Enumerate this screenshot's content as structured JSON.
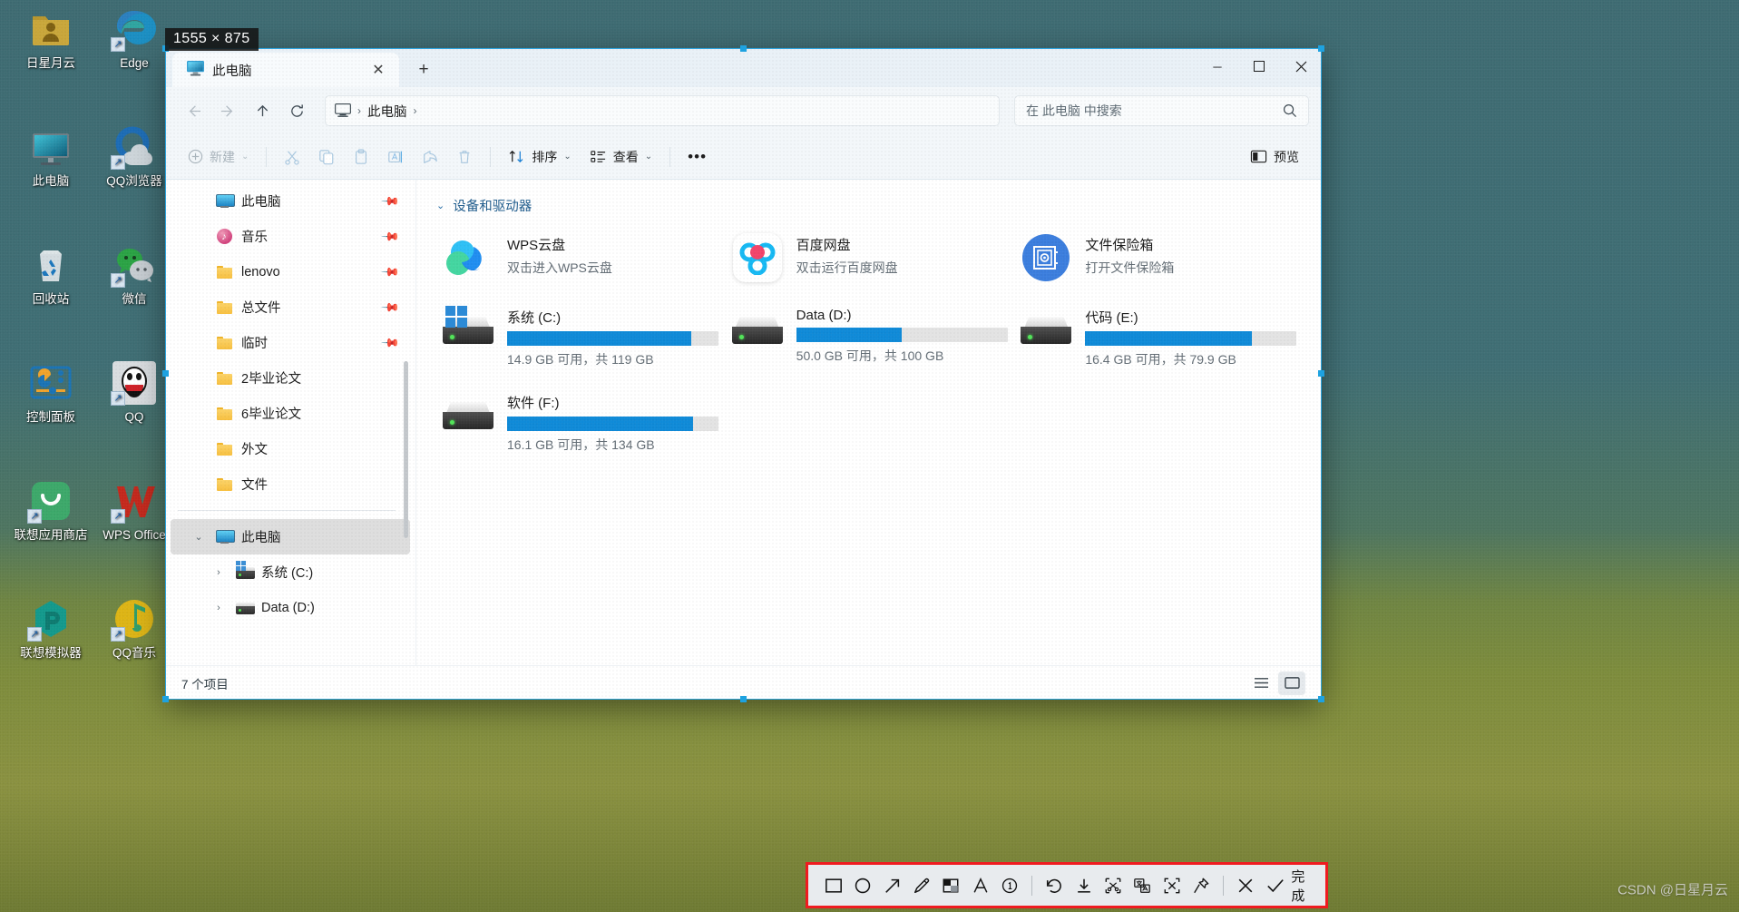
{
  "desktop": {
    "icons": [
      {
        "label": "日星月云",
        "icon": "folder-user-icon",
        "shortcut": false
      },
      {
        "label": "Edge",
        "icon": "edge-icon",
        "shortcut": true
      },
      {
        "label": "此电脑",
        "icon": "this-pc-icon",
        "shortcut": false
      },
      {
        "label": "QQ浏览器",
        "icon": "qq-browser-icon",
        "shortcut": true
      },
      {
        "label": "回收站",
        "icon": "recycle-bin-icon",
        "shortcut": false
      },
      {
        "label": "微信",
        "icon": "wechat-icon",
        "shortcut": true
      },
      {
        "label": "控制面板",
        "icon": "control-panel-icon",
        "shortcut": false
      },
      {
        "label": "QQ",
        "icon": "qq-icon",
        "shortcut": true
      },
      {
        "label": "联想应用商店",
        "icon": "lenovo-store-icon",
        "shortcut": true
      },
      {
        "label": "WPS Office",
        "icon": "wps-office-icon",
        "shortcut": true
      },
      {
        "label": "联想模拟器",
        "icon": "lenovo-emulator-icon",
        "shortcut": true
      },
      {
        "label": "QQ音乐",
        "icon": "qq-music-icon",
        "shortcut": true
      }
    ]
  },
  "snip": {
    "size_badge": "1555 × 875",
    "done_label": "完成",
    "tools": [
      {
        "name": "rectangle-tool",
        "icon": "rectangle-icon"
      },
      {
        "name": "ellipse-tool",
        "icon": "ellipse-icon"
      },
      {
        "name": "arrow-tool",
        "icon": "arrow-icon"
      },
      {
        "name": "pen-tool",
        "icon": "pencil-icon"
      },
      {
        "name": "mosaic-tool",
        "icon": "mosaic-icon"
      },
      {
        "name": "text-tool",
        "icon": "text-a-icon"
      },
      {
        "name": "step-number-tool",
        "icon": "circled-one-icon"
      },
      {
        "name": "undo-tool",
        "icon": "undo-icon"
      },
      {
        "name": "save-tool",
        "icon": "download-icon"
      },
      {
        "name": "cut-tool",
        "icon": "scissors-icon"
      },
      {
        "name": "translate-tool",
        "icon": "translate-icon"
      },
      {
        "name": "ocr-tool",
        "icon": "ocr-extract-icon"
      },
      {
        "name": "pin-tool",
        "icon": "pin-icon"
      },
      {
        "name": "cancel-tool",
        "icon": "close-x-icon"
      }
    ]
  },
  "watermark": "CSDN @日星月云",
  "window": {
    "tab": {
      "title": "此电脑",
      "icon": "this-pc-icon",
      "close_label": "✕"
    },
    "new_tab_label": "+",
    "controls": {
      "minimize": "─",
      "maximize": "▢",
      "close": "✕"
    },
    "nav": {
      "back": "back-arrow",
      "forward": "forward-arrow",
      "up": "up-arrow",
      "refresh": "refresh-arrow"
    },
    "breadcrumb": {
      "root_icon": "this-pc-icon",
      "sep1": "›",
      "item": "此电脑",
      "sep2": "›"
    },
    "search": {
      "placeholder": "在 此电脑 中搜索",
      "icon": "search-icon"
    },
    "toolbar": {
      "new_label": "新建",
      "cut_label": "剪切",
      "copy_label": "复制",
      "paste_label": "粘贴",
      "rename_label": "重命名",
      "share_label": "共享",
      "delete_label": "删除",
      "sort_label": "排序",
      "view_label": "查看",
      "more_label": "•••",
      "preview_label": "预览"
    }
  },
  "sidebar": {
    "quick_items": [
      {
        "label": "此电脑",
        "icon": "monitor-icon",
        "pinned": true
      },
      {
        "label": "音乐",
        "icon": "music-icon",
        "pinned": true
      },
      {
        "label": "lenovo",
        "icon": "folder-icon",
        "pinned": true
      },
      {
        "label": "总文件",
        "icon": "folder-icon",
        "pinned": true
      },
      {
        "label": "临时",
        "icon": "folder-icon",
        "pinned": true
      },
      {
        "label": "2毕业论文",
        "icon": "folder-icon",
        "pinned": false
      },
      {
        "label": "6毕业论文",
        "icon": "folder-icon",
        "pinned": false
      },
      {
        "label": "外文",
        "icon": "folder-icon",
        "pinned": false
      },
      {
        "label": "文件",
        "icon": "folder-icon",
        "pinned": false
      }
    ],
    "tree": [
      {
        "label": "此电脑",
        "icon": "monitor-icon",
        "chevron": "⌄",
        "selected": true,
        "indent": 0
      },
      {
        "label": "系统 (C:)",
        "icon": "windows-drive-icon",
        "chevron": "›",
        "selected": false,
        "indent": 1
      },
      {
        "label": "Data (D:)",
        "icon": "hdd-icon",
        "chevron": "›",
        "selected": false,
        "indent": 1
      }
    ]
  },
  "content": {
    "group_title": "设备和驱动器",
    "group_chevron": "⌄",
    "apps": [
      {
        "name": "WPS云盘",
        "sub": "双击进入WPS云盘",
        "icon": "wps-cloud-icon"
      },
      {
        "name": "百度网盘",
        "sub": "双击运行百度网盘",
        "icon": "baidu-netdisk-icon"
      },
      {
        "name": "文件保险箱",
        "sub": "打开文件保险箱",
        "icon": "file-vault-icon"
      }
    ],
    "drives": [
      {
        "name": "系统 (C:)",
        "sub": "14.9 GB 可用，共 119 GB",
        "used_pct": 87,
        "icon": "windows-drive-icon",
        "low": false
      },
      {
        "name": "Data (D:)",
        "sub": "50.0 GB 可用，共 100 GB",
        "used_pct": 50,
        "icon": "hdd-icon",
        "low": false
      },
      {
        "name": "代码 (E:)",
        "sub": "16.4 GB 可用，共 79.9 GB",
        "used_pct": 79,
        "icon": "hdd-icon",
        "low": false
      },
      {
        "name": "软件 (F:)",
        "sub": "16.1 GB 可用，共 134 GB",
        "used_pct": 88,
        "icon": "hdd-icon",
        "low": false
      }
    ]
  },
  "status": {
    "item_count": "7 个项目",
    "list_view_icon": "list-view-icon",
    "detail_view_icon": "tile-view-icon"
  }
}
